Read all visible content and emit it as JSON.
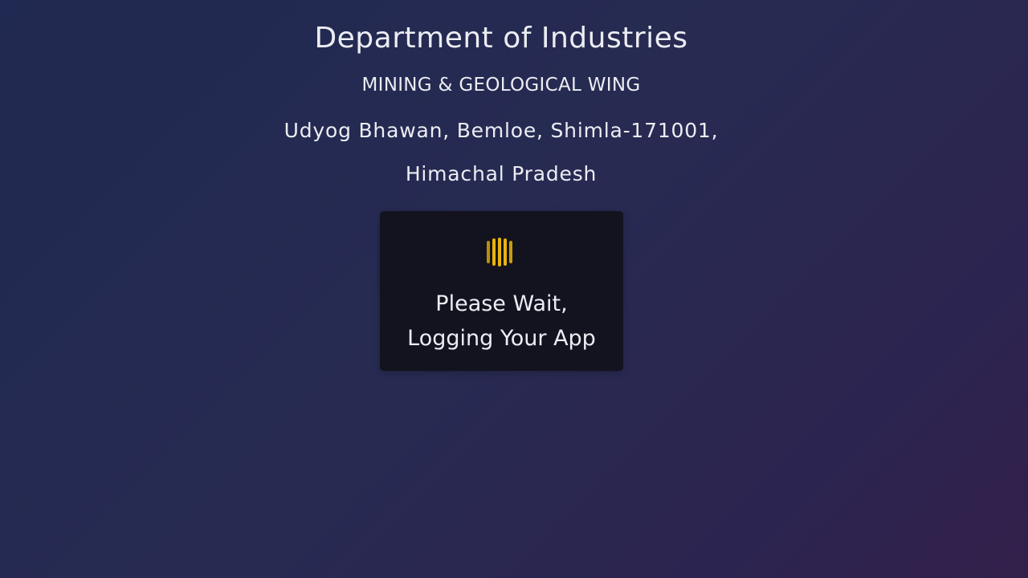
{
  "header": {
    "title": "Department of Industries",
    "wing": "MINING & GEOLOGICAL WING",
    "address_line1": "Udyog Bhawan, Bemloe, Shimla-171001,",
    "address_line2": "Himachal Pradesh"
  },
  "loader": {
    "icon": "loading-bars-icon",
    "line1": "Please Wait,",
    "line2": "Logging Your App",
    "accent_color": "#e9b30c"
  },
  "colors": {
    "background_start": "#1f2850",
    "background_end": "#32204a",
    "card": "#13131f",
    "text": "#ecedf3"
  }
}
